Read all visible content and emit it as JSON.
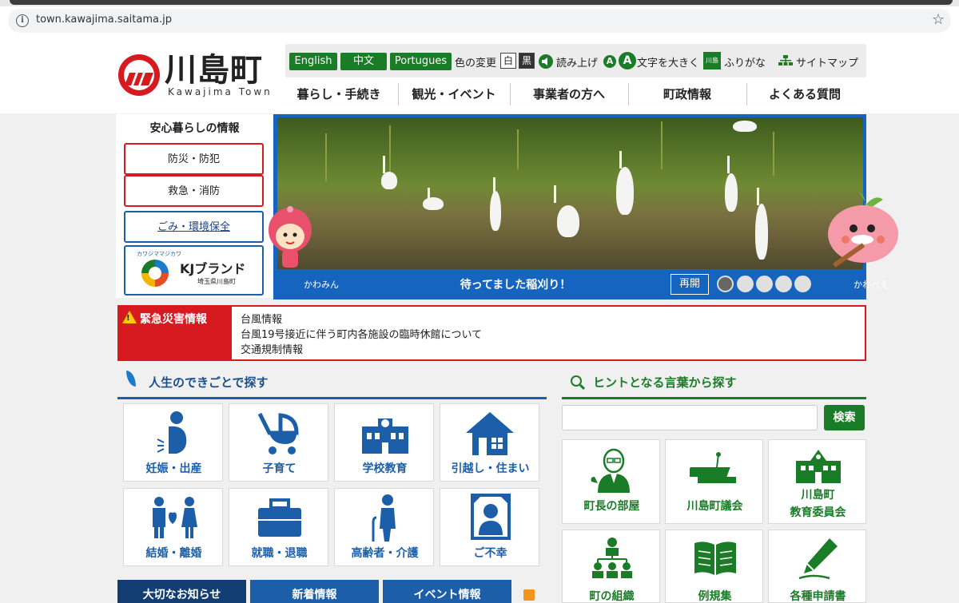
{
  "browser": {
    "url": "town.kawajima.saitama.jp"
  },
  "header": {
    "logo_jp": "川島町",
    "logo_en": "Kawajima Town",
    "lang": {
      "english": "English",
      "chinese": "中文",
      "portuguese": "Portugues"
    },
    "color_change": "色の変更",
    "white": "白",
    "black": "黒",
    "read_aloud": "読み上げ",
    "font_small": "A",
    "font_large": "A",
    "font_size": "文字を大きく",
    "furigana_icon": "川島",
    "furigana": "ふりがな",
    "sitemap": "サイトマップ"
  },
  "gnav": [
    "暮らし・手続き",
    "観光・イベント",
    "事業者の方へ",
    "町政情報",
    "よくある質問"
  ],
  "safety": {
    "title": "安心暮らしの情報",
    "items": [
      "防災・防犯",
      "救急・消防",
      "ごみ・環境保全"
    ],
    "kj_brand": "KJブランド",
    "kj_sub": "埼玉県川島町",
    "kj_ruby": "カワジママジカワ"
  },
  "slider": {
    "caption": "待ってました稲刈り！",
    "left_mascot": "かわみん",
    "right_mascot": "かわべえ",
    "pause": "再開",
    "slides": 5,
    "active": 1
  },
  "emergency": {
    "title": "緊急災害情報",
    "links": [
      "台風情報",
      "台風19号接近に伴う町内各施設の臨時休館について",
      "交通規制情報"
    ]
  },
  "life": {
    "title": "人生のできごとで探す",
    "items": [
      "妊娠・出産",
      "子育て",
      "学校教育",
      "引越し・住まい",
      "結婚・離婚",
      "就職・退職",
      "高齢者・介護",
      "ご不幸"
    ]
  },
  "tabs": [
    "大切なお知らせ",
    "新着情報",
    "イベント情報"
  ],
  "hint": {
    "title": "ヒントとなる言葉から探す",
    "placeholder": "",
    "search_label": "検索",
    "items": [
      "町長の部屋",
      "川島町議会",
      "川島町",
      "教育委員会",
      "町の組織",
      "例規集",
      "各種申請書"
    ]
  },
  "colors": {
    "blue": "#1c5fa8",
    "green": "#1b7c28",
    "red": "#d71920"
  }
}
